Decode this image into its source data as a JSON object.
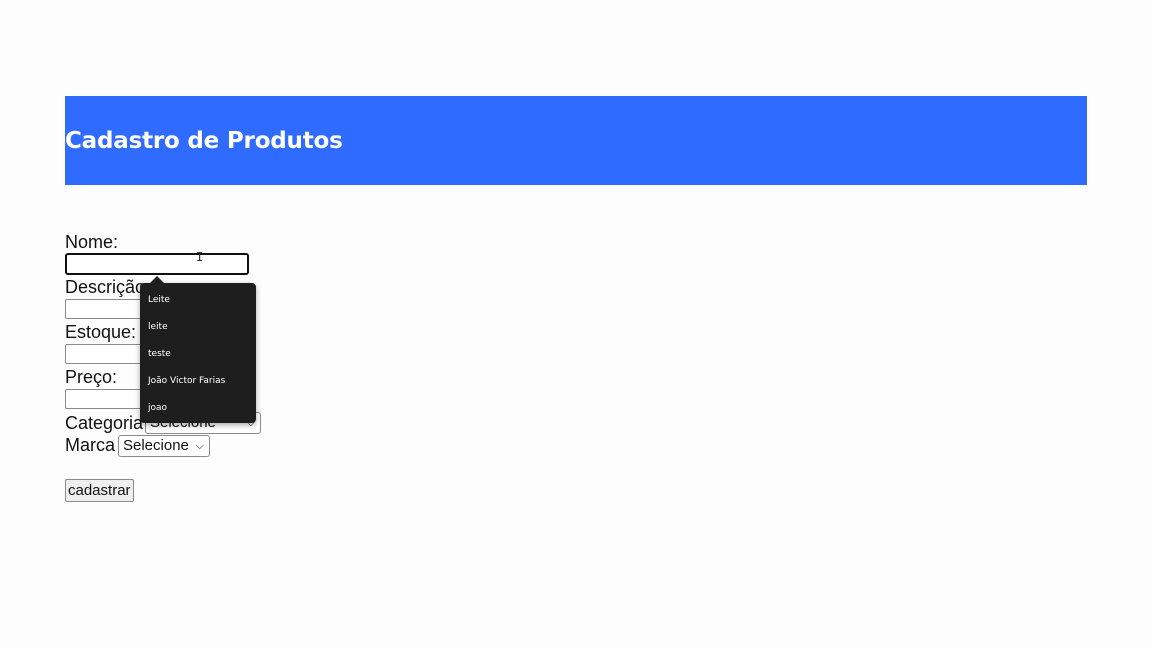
{
  "header": {
    "title": "Cadastro de Produtos"
  },
  "form": {
    "nome_label": "Nome:",
    "nome_value": "",
    "descricao_label": "Descrição:",
    "estoque_label": "Estoque:",
    "preco_label": "Preço:",
    "categoria_label": "Categoria",
    "categoria_selected": "Selecione",
    "marca_label": "Marca",
    "marca_selected": "Selecione",
    "submit_label": "cadastrar"
  },
  "autocomplete": {
    "suggestions": [
      "Leite",
      "leite",
      "teste",
      "João Victor Farias",
      "joao"
    ]
  },
  "colors": {
    "header_background": "#2f6bff",
    "dropdown_background": "#1e1e1e"
  },
  "icons": {
    "cursor": "text-cursor-icon",
    "select_arrow": "chevron-down-icon"
  }
}
